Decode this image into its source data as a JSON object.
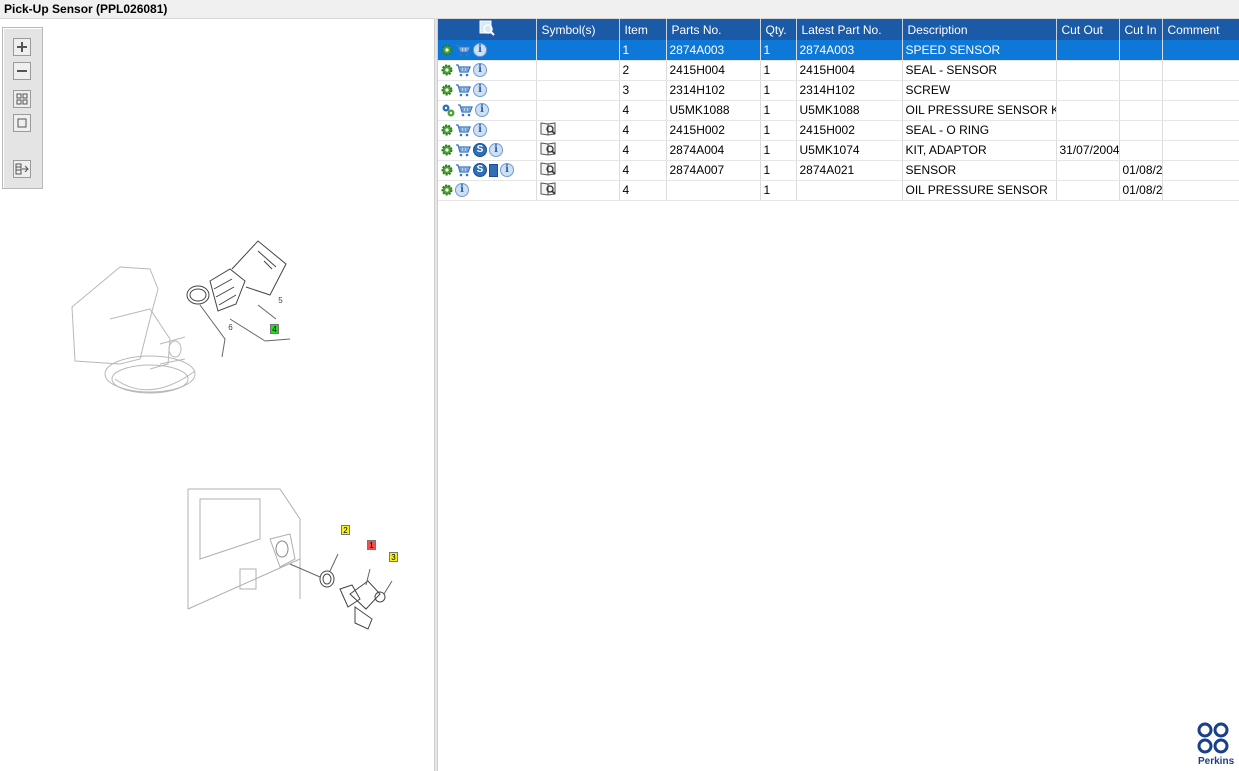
{
  "window": {
    "title": "Pick-Up Sensor (PPL026081)"
  },
  "toolbar": {
    "buttons": [
      {
        "name": "zoom-in",
        "icon": "plus-icon"
      },
      {
        "name": "zoom-out",
        "icon": "minus-icon"
      },
      {
        "name": "fit-all",
        "icon": "grid-icon"
      },
      {
        "name": "actual-size",
        "icon": "square-icon"
      },
      {
        "name": "export",
        "icon": "export-icon"
      }
    ]
  },
  "drawing": {
    "callouts_top": [
      {
        "label": "5",
        "style": "plain"
      },
      {
        "label": "6",
        "style": "plain"
      },
      {
        "label": "4",
        "style": "green"
      }
    ],
    "callouts_bottom": [
      {
        "label": "2",
        "style": "yellow"
      },
      {
        "label": "1",
        "style": "red"
      },
      {
        "label": "3",
        "style": "yellow"
      }
    ]
  },
  "table": {
    "columns": [
      "",
      "Symbol(s)",
      "Item",
      "Parts No.",
      "Qty.",
      "Latest Part No.",
      "Description",
      "Cut Out",
      "Cut In",
      "Comment"
    ],
    "rows": [
      {
        "icons": [
          "gear",
          "cart",
          "info"
        ],
        "symbol": false,
        "item": "1",
        "part_no": "2874A003",
        "qty": "1",
        "latest": "2874A003",
        "description": "SPEED SENSOR",
        "cut_out": "",
        "cut_in": "",
        "comment": "",
        "selected": true
      },
      {
        "icons": [
          "gear",
          "cart",
          "info"
        ],
        "symbol": false,
        "item": "2",
        "part_no": "2415H004",
        "qty": "1",
        "latest": "2415H004",
        "description": "SEAL - SENSOR",
        "cut_out": "",
        "cut_in": "",
        "comment": "",
        "selected": false
      },
      {
        "icons": [
          "gear",
          "cart",
          "info"
        ],
        "symbol": false,
        "item": "3",
        "part_no": "2314H102",
        "qty": "1",
        "latest": "2314H102",
        "description": "SCREW",
        "cut_out": "",
        "cut_in": "",
        "comment": "",
        "selected": false
      },
      {
        "icons": [
          "gears",
          "cart",
          "info"
        ],
        "symbol": false,
        "item": "4",
        "part_no": "U5MK1088",
        "qty": "1",
        "latest": "U5MK1088",
        "description": "OIL PRESSURE SENSOR KIT",
        "cut_out": "",
        "cut_in": "",
        "comment": "",
        "selected": false
      },
      {
        "icons": [
          "gear",
          "cart",
          "info"
        ],
        "symbol": true,
        "item": "4",
        "part_no": "2415H002",
        "qty": "1",
        "latest": "2415H002",
        "description": "SEAL - O RING",
        "cut_out": "",
        "cut_in": "",
        "comment": "",
        "selected": false
      },
      {
        "icons": [
          "gear",
          "cart",
          "s",
          "info"
        ],
        "symbol": true,
        "item": "4",
        "part_no": "2874A004",
        "qty": "1",
        "latest": "U5MK1074",
        "description": "KIT, ADAPTOR",
        "cut_out": "31/07/2004",
        "cut_in": "",
        "comment": "",
        "selected": false
      },
      {
        "icons": [
          "gear",
          "cart",
          "s",
          "doc",
          "info"
        ],
        "symbol": true,
        "item": "4",
        "part_no": "2874A007",
        "qty": "1",
        "latest": "2874A021",
        "description": "SENSOR",
        "cut_out": "",
        "cut_in": "01/08/2",
        "comment": "",
        "selected": false
      },
      {
        "icons": [
          "gear",
          "info"
        ],
        "symbol": true,
        "item": "4",
        "part_no": "",
        "qty": "1",
        "latest": "",
        "description": "OIL PRESSURE SENSOR",
        "cut_out": "",
        "cut_in": "01/08/2",
        "comment": "",
        "selected": false
      }
    ]
  },
  "brand": {
    "name": "Perkins",
    "color": "#1a3f8c"
  },
  "colors": {
    "header": "#1a5aa6",
    "selected_row": "#0d78d8",
    "callout_green": "#22dd22",
    "callout_yellow": "#f6f020",
    "callout_red": "#f05050"
  }
}
